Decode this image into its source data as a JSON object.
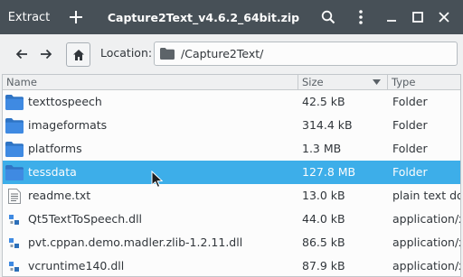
{
  "window": {
    "title": "Capture2Text_v4.6.2_64bit.zip",
    "extract_label": "Extract",
    "colors": {
      "titlebar": "#475057",
      "selection": "#3daee9",
      "folder": "#3f8ae2"
    }
  },
  "toolbar": {
    "location_label": "Location:",
    "location_value": "/Capture2Text/"
  },
  "columns": {
    "name": "Name",
    "size": "Size",
    "type": "Type"
  },
  "files": [
    {
      "name": "texttospeech",
      "size": "42.5 kB",
      "type": "Folder",
      "icon": "folder-icon"
    },
    {
      "name": "imageformats",
      "size": "314.4 kB",
      "type": "Folder",
      "icon": "folder-icon"
    },
    {
      "name": "platforms",
      "size": "1.3 MB",
      "type": "Folder",
      "icon": "folder-icon"
    },
    {
      "name": "tessdata",
      "size": "127.8 MB",
      "type": "Folder",
      "icon": "folder-icon",
      "selected": true
    },
    {
      "name": "readme.txt",
      "size": "13.0 kB",
      "type": "plain text doc",
      "icon": "text-file-icon"
    },
    {
      "name": "Qt5TextToSpeech.dll",
      "size": "44.0 kB",
      "type": "application/x-",
      "icon": "dll-file-icon"
    },
    {
      "name": "pvt.cppan.demo.madler.zlib-1.2.11.dll",
      "size": "86.5 kB",
      "type": "application/x-",
      "icon": "dll-file-icon"
    },
    {
      "name": "vcruntime140.dll",
      "size": "87.9 kB",
      "type": "application/x-",
      "icon": "dll-file-icon"
    }
  ]
}
